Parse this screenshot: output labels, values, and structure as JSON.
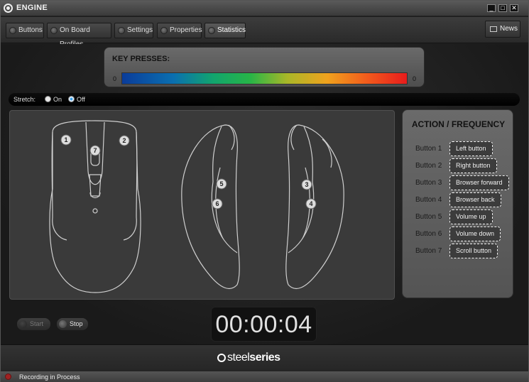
{
  "window": {
    "title": "ENGINE",
    "controls": {
      "minimize": "_",
      "maximize": "□",
      "close": "✕"
    }
  },
  "toolbar": {
    "tabs": [
      {
        "label": "Buttons",
        "active": false
      },
      {
        "label": "On Board Profiles",
        "active": false
      },
      {
        "label": "Settings",
        "active": false
      },
      {
        "label": "Properties",
        "active": false
      },
      {
        "label": "Statistics",
        "active": true
      }
    ],
    "news_label": "News"
  },
  "key_presses": {
    "label": "KEY PRESSES:",
    "min": "0",
    "max": "0",
    "gradient_colors": [
      "#0a3c9a",
      "#12a56e",
      "#27b547",
      "#f0a21d",
      "#e81c1c"
    ]
  },
  "stretch": {
    "label": "Stretch:",
    "options": [
      {
        "label": "On",
        "checked": false
      },
      {
        "label": "Off",
        "checked": true
      }
    ]
  },
  "mouse_diagram": {
    "top_view_markers": [
      "1",
      "2",
      "7"
    ],
    "left_view_markers": [
      "5",
      "6"
    ],
    "right_view_markers": [
      "3",
      "4"
    ]
  },
  "action_frequency": {
    "title": "ACTION / FREQUENCY",
    "rows": [
      {
        "key": "Button 1",
        "value": "Left button"
      },
      {
        "key": "Button 2",
        "value": "Right button"
      },
      {
        "key": "Button 3",
        "value": "Browser forward"
      },
      {
        "key": "Button 4",
        "value": "Browser back"
      },
      {
        "key": "Button 5",
        "value": "Volume up"
      },
      {
        "key": "Button 6",
        "value": "Volume down"
      },
      {
        "key": "Button 7",
        "value": "Scroll button"
      }
    ]
  },
  "recording": {
    "start_label": "Start",
    "stop_label": "Stop",
    "start_enabled": false,
    "timer": "00:00:04"
  },
  "footer": {
    "logo_light": "steel",
    "logo_bold": "series"
  },
  "status": {
    "text": "Recording in Process",
    "led_color": "#a02222"
  }
}
